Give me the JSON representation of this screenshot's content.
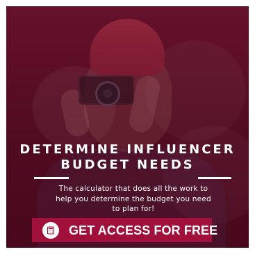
{
  "headline": {
    "line1": "DETERMINE INFLUENCER",
    "line2": "BUDGET NEEDS"
  },
  "description": {
    "line1": "The calculator that does all the work to",
    "line2": "help you determine the budget you need",
    "line3": "to plan for!"
  },
  "cta": {
    "label": "GET ACCESS FOR FREE",
    "icon": "calculator-icon"
  },
  "colors": {
    "accent": "#a10f3b",
    "overlay": "#5f0a26",
    "text": "#ffffff"
  }
}
